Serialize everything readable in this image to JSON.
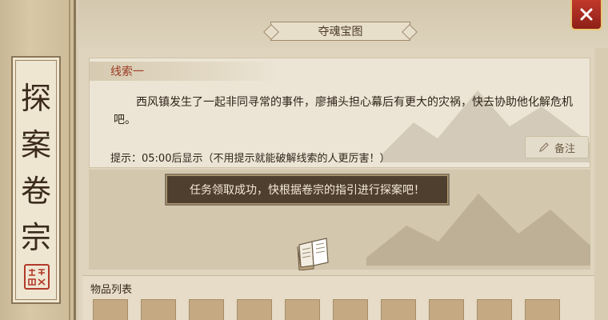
{
  "scroll_banner": {
    "chars": [
      "探",
      "案",
      "卷",
      "宗"
    ],
    "seal_text": "天下\n刑名"
  },
  "header": {
    "title": "夺魂宝图"
  },
  "clue": {
    "label": "线索一",
    "text": "西风镇发生了一起非同寻常的事件，廖捕头担心幕后有更大的灾祸，快去协助他化解危机吧。",
    "hint": "提示：05:00后显示（不用提示就能破解线索的人更厉害！）",
    "note_button": "备注"
  },
  "toast": {
    "message": "任务领取成功，快根据卷宗的指引进行探案吧！"
  },
  "items": {
    "label": "物品列表",
    "slot_count": 10
  },
  "colors": {
    "accent_red": "#9c3b22",
    "close_red": "#c0392b",
    "parchment": "#ece5d6"
  },
  "icons": {
    "close": "close-icon",
    "note": "pencil-icon",
    "book": "book-icon"
  }
}
